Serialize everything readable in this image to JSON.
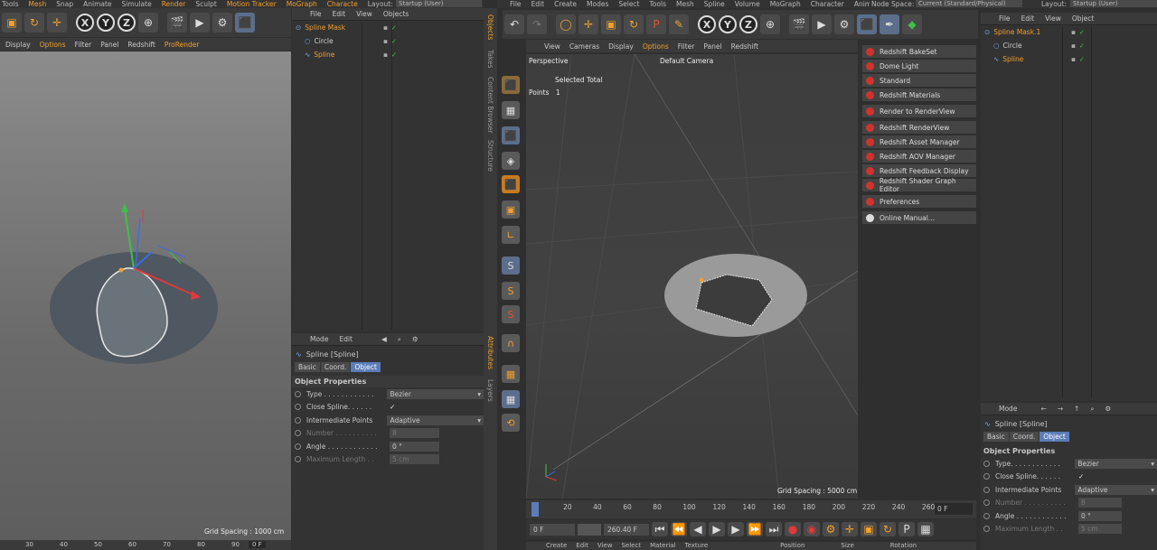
{
  "left_window": {
    "menu": [
      "Tools",
      "Mesh",
      "Snap",
      "Animate",
      "Simulate",
      "Render",
      "Sculpt",
      "Motion Tracker",
      "MoGraph",
      "Characte"
    ],
    "layout_label": "Layout:",
    "layout_value": "Startup (User)",
    "viewport_menu": [
      "Display",
      "Options",
      "Filter",
      "Panel",
      "Redshift",
      "ProRender"
    ],
    "grid_spacing": "Grid Spacing : 1000 cm",
    "timeline_ticks": [
      "30",
      "40",
      "50",
      "60",
      "70",
      "80",
      "90"
    ],
    "timeline_frame": "0 F",
    "objects_menu": [
      "File",
      "Edit",
      "View",
      "Objects"
    ],
    "objects": [
      {
        "name": "Spline Mask",
        "indent": 0,
        "color": "#f0a030"
      },
      {
        "name": "Circle",
        "indent": 1,
        "color": "#cfcfcf"
      },
      {
        "name": "Spline",
        "indent": 1,
        "color": "#f0a030"
      }
    ],
    "side_tabs": [
      "Objects",
      "Takes",
      "Content Browser",
      "Structure"
    ],
    "attr_side_tabs": [
      "Attributes",
      "Layers"
    ],
    "attr_menu": [
      "Mode",
      "Edit"
    ],
    "attr_title": "Spline [Spline]",
    "attr_tabs": [
      "Basic",
      "Coord.",
      "Object"
    ],
    "attr_section": "Object Properties",
    "props": [
      {
        "label": "Type . . . . . . . . . . . . .",
        "value": "Bezier",
        "kind": "select",
        "dim": false
      },
      {
        "label": "Close Spline. . . . . .",
        "value": "✓",
        "kind": "check",
        "dim": false
      },
      {
        "label": "Intermediate Points",
        "value": "Adaptive",
        "kind": "select",
        "dim": false
      },
      {
        "label": "Number . . . . . . . . . .",
        "value": "8",
        "kind": "num",
        "dim": true
      },
      {
        "label": "Angle . . . . . . . . . . . .",
        "value": "0 °",
        "kind": "num",
        "dim": false
      },
      {
        "label": "Maximum Length . . .",
        "value": "5 cm",
        "kind": "num",
        "dim": true
      }
    ]
  },
  "right_window": {
    "menu": [
      "File",
      "Edit",
      "Create",
      "Modes",
      "Select",
      "Tools",
      "Mesh",
      "Spline",
      "Volume",
      "MoGraph",
      "Character",
      "Anima"
    ],
    "node_space_label": "Node Space:",
    "node_space_value": "Current (Standard/Physical)",
    "layout_label": "Layout:",
    "layout_value": "Startup (User)",
    "viewport_menu": [
      "View",
      "Cameras",
      "Display",
      "Options",
      "Filter",
      "Panel",
      "Redshift"
    ],
    "viewport_label": "Perspective",
    "camera_label": "Default Camera",
    "stats_header": "Selected Total",
    "stats_label": "Points",
    "stats_value": "1",
    "grid_spacing": "Grid Spacing : 5000 cm",
    "redshift_menu": [
      "Redshift BakeSet",
      "Dome Light",
      "Standard",
      "Redshift Materials",
      "Render to RenderView",
      "Redshift RenderView",
      "Redshift Asset Manager",
      "Redshift AOV Manager",
      "Redshift Feedback Display",
      "Redshift Shader Graph Editor",
      "Preferences",
      "Online Manual..."
    ],
    "timeline_ticks": [
      "0",
      "20",
      "40",
      "60",
      "80",
      "100",
      "120",
      "140",
      "160",
      "180",
      "200",
      "220",
      "240",
      "260"
    ],
    "timeline_frame": "0 F",
    "time_start": "0 F",
    "time_end": "260.40 F",
    "bottom_menu": [
      "Create",
      "Edit",
      "View",
      "Select",
      "Material",
      "Texture"
    ],
    "coord_headers": [
      "Position",
      "Size",
      "Rotation"
    ],
    "objects_menu": [
      "File",
      "Edit",
      "View",
      "Object"
    ],
    "objects": [
      {
        "name": "Spline Mask.1",
        "indent": 0,
        "color": "#f0a030"
      },
      {
        "name": "Circle",
        "indent": 1,
        "color": "#cfcfcf"
      },
      {
        "name": "Spline",
        "indent": 1,
        "color": "#f0a030"
      }
    ],
    "attr_menu": [
      "Mode"
    ],
    "attr_title": "Spline [Spline]",
    "attr_tabs": [
      "Basic",
      "Coord.",
      "Object"
    ],
    "attr_section": "Object Properties",
    "props": [
      {
        "label": "Type. . . . . . . . . . . .",
        "value": "Bezier",
        "kind": "select",
        "dim": false
      },
      {
        "label": "Close Spline. . . . . .",
        "value": "✓",
        "kind": "check",
        "dim": false
      },
      {
        "label": "Intermediate Points",
        "value": "Adaptive",
        "kind": "select",
        "dim": false
      },
      {
        "label": "Number . . . . . . . . . .",
        "value": "8",
        "kind": "num",
        "dim": true
      },
      {
        "label": "Angle . . . . . . . . . . . .",
        "value": "0 °",
        "kind": "num",
        "dim": false
      },
      {
        "label": "Maximum Length . . .",
        "value": "5 cm",
        "kind": "num",
        "dim": true
      }
    ]
  },
  "axis_labels": [
    "X",
    "Y",
    "Z"
  ],
  "colors": {
    "accent": "#f0a030",
    "select": "#5b7db8",
    "axis_x": "#e03a3a",
    "axis_y": "#3fc04a",
    "axis_z": "#3a6ee0",
    "redshift": "#d0332e"
  }
}
